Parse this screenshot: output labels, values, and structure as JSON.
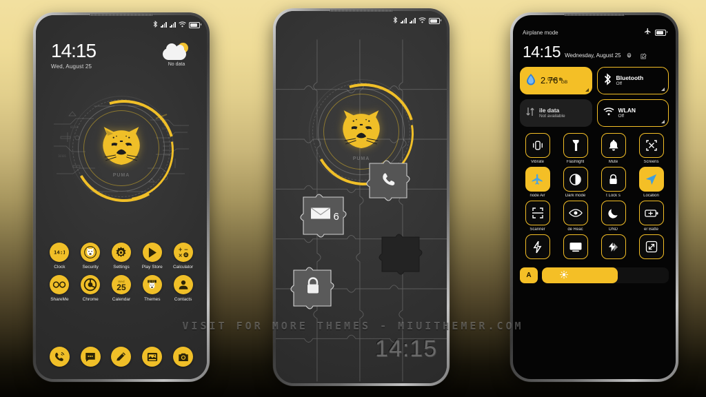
{
  "watermark": "VISIT FOR MORE THEMES - MIUITHEMER.COM",
  "theme": {
    "accent": "#f4bf26",
    "wallpaper_dark": "#2f2f2f",
    "panel_black": "#050505",
    "background_top": "#f2e0a0",
    "background_bottom": "#050401"
  },
  "phone1": {
    "statusbar": {
      "bluetooth": "bluetooth-icon",
      "signal1": "signal-bars-icon",
      "signal2": "signal-bars-icon",
      "wifi": "wifi-icon",
      "battery": "battery-icon"
    },
    "clock": {
      "time": "14:15",
      "date": "Wed, August 25"
    },
    "weather": {
      "icon": "partly-cloudy-icon",
      "label": "No data"
    },
    "widget": {
      "name": "tiger-hud-widget",
      "wordmark": "PUMA"
    },
    "apps_row1": [
      {
        "label": "Clock",
        "icon": "clock-icon"
      },
      {
        "label": "Security",
        "icon": "security-tiger-icon"
      },
      {
        "label": "Settings",
        "icon": "gear-icon"
      },
      {
        "label": "Play Store",
        "icon": "play-store-icon"
      },
      {
        "label": "Calculator",
        "icon": "calculator-icon"
      }
    ],
    "apps_row2": [
      {
        "label": "ShareMe",
        "icon": "shareme-icon"
      },
      {
        "label": "Chrome",
        "icon": "chrome-icon"
      },
      {
        "label": "Calendar",
        "icon": "calendar-icon",
        "day": "25",
        "weekday": "Wed"
      },
      {
        "label": "Themes",
        "icon": "themes-icon"
      },
      {
        "label": "Contacts",
        "icon": "contacts-icon"
      }
    ],
    "dock": [
      {
        "label": "Phone",
        "icon": "phone-icon"
      },
      {
        "label": "Messages",
        "icon": "message-bubble-icon"
      },
      {
        "label": "Notes",
        "icon": "pencil-icon"
      },
      {
        "label": "Gallery",
        "icon": "gallery-icon"
      },
      {
        "label": "Camera",
        "icon": "camera-icon"
      }
    ]
  },
  "phone2": {
    "statusbar": {
      "bluetooth": "bluetooth-icon",
      "signal1": "signal-bars-icon",
      "signal2": "signal-bars-icon",
      "wifi": "wifi-icon",
      "battery": "battery-icon"
    },
    "clock": {
      "time": "14:15"
    },
    "widget": {
      "name": "tiger-hud-widget",
      "wordmark": "PUMA"
    },
    "puzzle_pieces": [
      {
        "icon": "phone-icon",
        "badge": ""
      },
      {
        "icon": "mail-envelope-icon",
        "badge": "6"
      },
      {
        "icon": "lock-icon",
        "badge": ""
      },
      {
        "icon": "empty-slot",
        "badge": ""
      }
    ]
  },
  "phone3": {
    "statusbar": {
      "airplane_label": "Airplane mode",
      "airplane_icon": "airplane-icon",
      "battery": "battery-icon"
    },
    "header": {
      "time": "14:15",
      "date": "Wednesday, August 25",
      "settings_icon": "gear-icon",
      "edit_icon": "edit-pencil-icon"
    },
    "big_tiles": [
      {
        "name": "data-usage-tile",
        "title": "2.76",
        "unit": "GB",
        "top_label_left": "h",
        "top_label_right": "Used th",
        "icon": "data-drop-icon",
        "state": "on"
      },
      {
        "name": "bluetooth-tile",
        "title": "Bluetooth",
        "subtitle": "Off",
        "icon": "bluetooth-icon",
        "state": "outline"
      },
      {
        "name": "mobile-data-tile",
        "title": "ile data",
        "subtitle": "Not available",
        "icon": "mobile-data-icon",
        "state": "off"
      },
      {
        "name": "wlan-tile",
        "title": "WLAN",
        "subtitle": "Off",
        "icon": "wifi-icon",
        "state": "outline"
      }
    ],
    "quick_settings": [
      {
        "label": "Vibrate",
        "icon": "vibrate-icon",
        "state": "outline"
      },
      {
        "label": "Flashlight",
        "icon": "flashlight-icon",
        "state": "outline"
      },
      {
        "label": "Mute",
        "icon": "bell-icon",
        "state": "outline"
      },
      {
        "label": "Screens",
        "icon": "screenshot-icon",
        "state": "outline"
      },
      {
        "label": "node     Air",
        "icon": "airplane-icon",
        "state": "on"
      },
      {
        "label": "Dark mode",
        "icon": "dark-mode-icon",
        "state": "outline"
      },
      {
        "label": "t    Lock s",
        "icon": "lock-icon",
        "state": "outline"
      },
      {
        "label": "Location",
        "icon": "location-arrow-icon",
        "state": "on"
      },
      {
        "label": "Scanner",
        "icon": "scanner-icon",
        "state": "outline"
      },
      {
        "label": "de    Reac",
        "icon": "eye-icon",
        "state": "outline"
      },
      {
        "label": "DND",
        "icon": "moon-icon",
        "state": "outline"
      },
      {
        "label": "er    Batte",
        "icon": "battery-saver-icon",
        "state": "outline"
      },
      {
        "label": "",
        "icon": "lightning-icon",
        "state": "outline"
      },
      {
        "label": "",
        "icon": "cast-screen-icon",
        "state": "outline"
      },
      {
        "label": "",
        "icon": "ultra-battery-icon",
        "state": "outline"
      },
      {
        "label": "",
        "icon": "expand-icon",
        "state": "outline"
      }
    ],
    "brightness": {
      "auto_label": "A",
      "icon": "sun-icon",
      "value_percent": 60
    }
  }
}
